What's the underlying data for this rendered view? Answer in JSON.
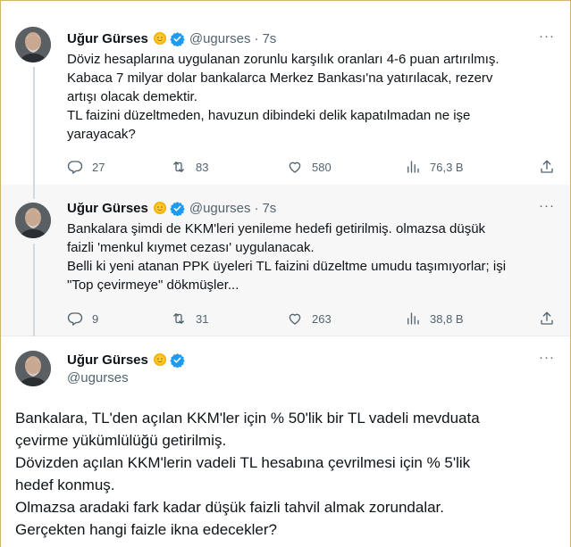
{
  "colors": {
    "text_primary": "#0f1419",
    "text_secondary": "#536471",
    "verified_blue": "#1d9bf0",
    "thread_line": "#cfd9de"
  },
  "tweets": [
    {
      "author": {
        "name": "Uğur Gürses",
        "handle": "@ugurses",
        "emoji": "sun-emoji",
        "verified": true
      },
      "time": "7s",
      "more_label": "···",
      "lines": [
        "Döviz hesaplarına uygulanan zorunlu karşılık oranları 4-6 puan artırılmış.",
        "Kabaca 7 milyar dolar bankalarca Merkez Bankası'na yatırılacak, rezerv",
        "artışı olacak demektir.",
        "TL faizini düzeltmeden, havuzun dibindeki delik kapatılmadan ne işe",
        "yarayacak?"
      ],
      "stats": {
        "replies": "27",
        "retweets": "83",
        "likes": "580",
        "views": "76,3 B"
      }
    },
    {
      "author": {
        "name": "Uğur Gürses",
        "handle": "@ugurses",
        "emoji": "sun-emoji",
        "verified": true
      },
      "time": "7s",
      "more_label": "···",
      "lines": [
        "Bankalara şimdi de KKM'leri yenileme hedefi getirilmiş. olmazsa düşük",
        "faizli 'menkul kıymet cezası' uygulanacak.",
        "Belli ki yeni atanan PPK üyeleri TL faizini düzeltme umudu taşımıyorlar; işi",
        "\"Top çevirmeye\" dökmüşler..."
      ],
      "stats": {
        "replies": "9",
        "retweets": "31",
        "likes": "263",
        "views": "38,8 B"
      }
    },
    {
      "author": {
        "name": "Uğur Gürses",
        "handle": "@ugurses",
        "emoji": "sun-emoji",
        "verified": true
      },
      "more_label": "···",
      "lines": [
        "Bankalara, TL'den açılan KKM'ler için % 50'lik bir TL vadeli mevduata",
        "çevirme yükümlülüğü getirilmiş.",
        "Dövizden açılan KKM'lerin vadeli TL hesabına çevrilmesi için % 5'lik",
        "hedef konmuş.",
        "Olmazsa aradaki fark kadar düşük faizli tahvil almak zorundalar.",
        "Gerçekten hangi faizle ikna edecekler?"
      ]
    }
  ]
}
